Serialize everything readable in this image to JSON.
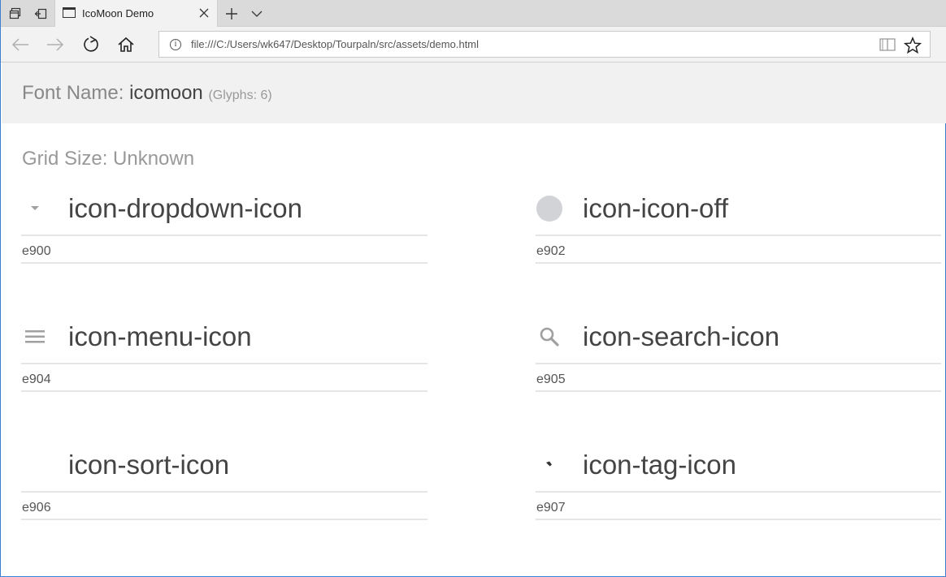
{
  "browser": {
    "tab_title": "IcoMoon Demo",
    "url": "file:///C:/Users/wk647/Desktop/Tourpaln/src/assets/demo.html"
  },
  "header": {
    "label": "Font Name:",
    "font_name": "icomoon",
    "glyph_count": "(Glyphs: 6)"
  },
  "grid_size": "Grid Size: Unknown",
  "glyphs": [
    {
      "name": "icon-dropdown-icon",
      "code": "e900",
      "icon": "dropdown-caret-icon"
    },
    {
      "name": "icon-icon-off",
      "code": "e902",
      "icon": "circle-off-icon"
    },
    {
      "name": "icon-menu-icon",
      "code": "e904",
      "icon": "hamburger-menu-icon"
    },
    {
      "name": "icon-search-icon",
      "code": "e905",
      "icon": "magnifier-icon"
    },
    {
      "name": "icon-sort-icon",
      "code": "e906",
      "icon": "blank-sort-icon"
    },
    {
      "name": "icon-tag-icon",
      "code": "e907",
      "icon": "tag-icon"
    }
  ]
}
